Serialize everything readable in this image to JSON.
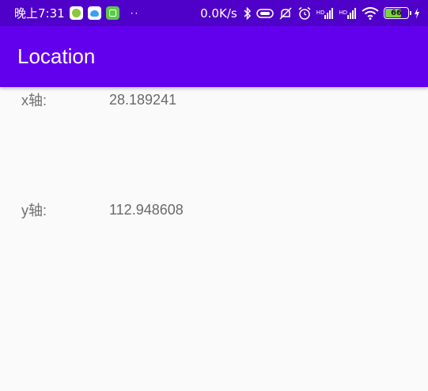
{
  "status_bar": {
    "time": "晚上7:31",
    "notifications": [
      "app-notification-icon",
      "app-notification-icon",
      "app-notification-icon"
    ],
    "more_indicator": "··",
    "network_speed": "0.0K/s",
    "battery_level": "66",
    "hd_label": "HD",
    "colors": {
      "background": "#4f00c9",
      "battery_fill": "#7cd246"
    }
  },
  "app_bar": {
    "title": "Location",
    "color": "#6200ee"
  },
  "coordinates": {
    "x_label": "x轴:",
    "x_value": "28.189241",
    "y_label": "y轴:",
    "y_value": "112.948608"
  }
}
